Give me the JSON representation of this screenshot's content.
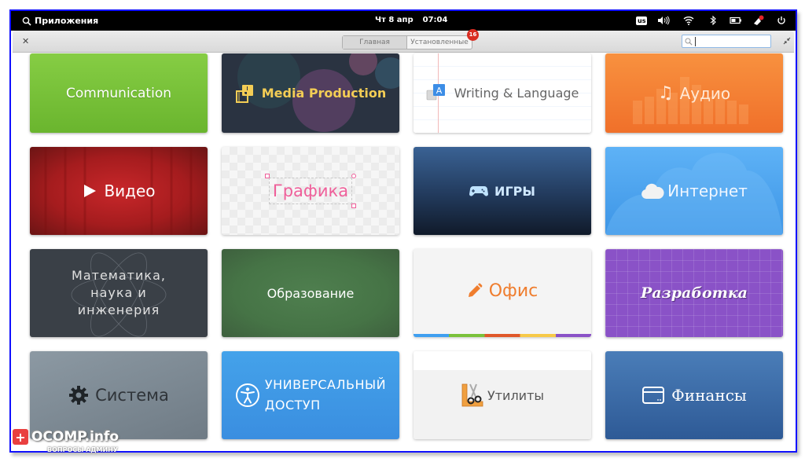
{
  "panel": {
    "apps_label": "Приложения",
    "date": "Чт  8 апр",
    "time": "07:04",
    "keyboard_layout": "us"
  },
  "header": {
    "tabs": [
      {
        "label": "Главная"
      },
      {
        "label": "Установленные",
        "badge": "16"
      }
    ],
    "search": {
      "value": "",
      "placeholder": ""
    }
  },
  "categories": [
    {
      "label": "Communication",
      "icon": "none",
      "bg": "#7ac13a",
      "text_color": "#ffffff"
    },
    {
      "label": "Media Production",
      "icon": "media-production-icon",
      "bg": "#2b3444",
      "text_color": "#f3cd55"
    },
    {
      "label": "Writing & Language",
      "icon": "writing-language-icon",
      "bg": "#ffffff",
      "text_color": "#666666"
    },
    {
      "label": "Аудио",
      "icon": "music-note-icon",
      "bg": "#f37c2b",
      "text_color": "#ffe9d6"
    },
    {
      "label": "Видео",
      "icon": "play-icon",
      "bg": "#9b1a1a",
      "text_color": "#ffffff"
    },
    {
      "label": "Графика",
      "icon": "none",
      "bg": "#f2f2f2",
      "text_color": "#ef5f9a"
    },
    {
      "label": "ИГРЫ",
      "icon": "gamepad-icon",
      "bg": "#223a5c",
      "text_color": "#cfe8ff"
    },
    {
      "label": "Интернет",
      "icon": "cloud-icon",
      "bg": "#4fa6ef",
      "text_color": "#f0f7ff"
    },
    {
      "label": "Математика,\nнаука и\nинженерия",
      "icon": "none",
      "bg": "#3a4047",
      "text_color": "#e0e0e0"
    },
    {
      "label": "Образование",
      "icon": "none",
      "bg": "#4e7b4f",
      "text_color": "#ffffff"
    },
    {
      "label": "Офис",
      "icon": "pencil-icon",
      "bg": "#f4f4f4",
      "text_color": "#ef7d2e"
    },
    {
      "label": "Разработка",
      "icon": "none",
      "bg": "#8a52c7",
      "text_color": "#ffffff"
    },
    {
      "label": "Система",
      "icon": "gear-icon",
      "bg": "#7e8b95",
      "text_color": "#2f3439"
    },
    {
      "label": "УНИВЕРСАЛЬНЫЙ\nДОСТУП",
      "icon": "accessibility-icon",
      "bg": "#3d97e3",
      "text_color": "#ffffff"
    },
    {
      "label": "Утилиты",
      "icon": "utilities-icon",
      "bg": "#f2f2f2",
      "text_color": "#555555"
    },
    {
      "label": "Финансы",
      "icon": "credit-card-icon",
      "bg": "#3565a0",
      "text_color": "#ffffff"
    }
  ],
  "watermark": {
    "title": "OCOMP.info",
    "subtitle": "ВОПРОСЫ АДМИНУ"
  }
}
